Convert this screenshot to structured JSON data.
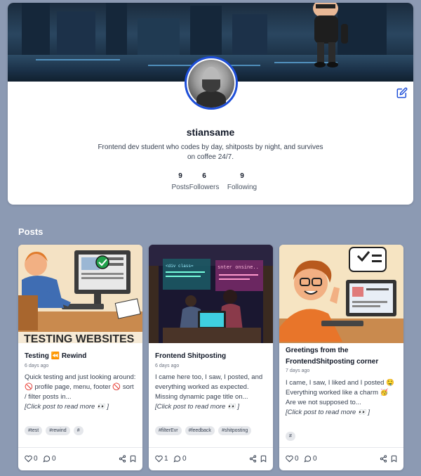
{
  "profile": {
    "username": "stiansame",
    "bio": "Frontend dev student who codes by day, shitposts by night, and survives on coffee 24/7.",
    "stats": [
      {
        "value": "9",
        "label": "Posts"
      },
      {
        "value": "6",
        "label": "Followers"
      },
      {
        "value": "9",
        "label": "Following"
      }
    ],
    "accent_color": "#1d4ed8"
  },
  "posts_heading": "Posts",
  "posts": [
    {
      "title": "Testing ⏪ Rewind",
      "date": "6 days ago",
      "excerpt": "Quick testing and just looking around: 🚫 profile page, menu, footer 🚫 sort / filter posts in...",
      "more": "[Click post to read more 👀 ]",
      "tags": [
        "#test",
        "#rewind",
        "#"
      ],
      "likes": "0",
      "comments": "0"
    },
    {
      "title": "Frontend Shitposting",
      "date": "6 days ago",
      "excerpt": "I came here too, I saw, I posted, and everything worked as expected. Missing dynamic page title on...",
      "more": "[Click post to read more 👀 ]",
      "tags": [
        "#filterEvr",
        "#feedback",
        "#shitposting"
      ],
      "likes": "1",
      "comments": "0"
    },
    {
      "title": "Greetings from the FrontendShitposting corner",
      "date": "7 days ago",
      "excerpt": "I came, I saw, I liked and I posted 🤤 Everything worked like a charm 🥳 Are we not supposed to...",
      "more": "[Click post to read more 👀 ]",
      "tags": [
        "#"
      ],
      "likes": "0",
      "comments": "0"
    }
  ],
  "icons": {
    "edit": "edit-icon",
    "like": "heart-icon",
    "comment": "comment-icon",
    "share": "share-icon",
    "bookmark": "bookmark-icon"
  }
}
